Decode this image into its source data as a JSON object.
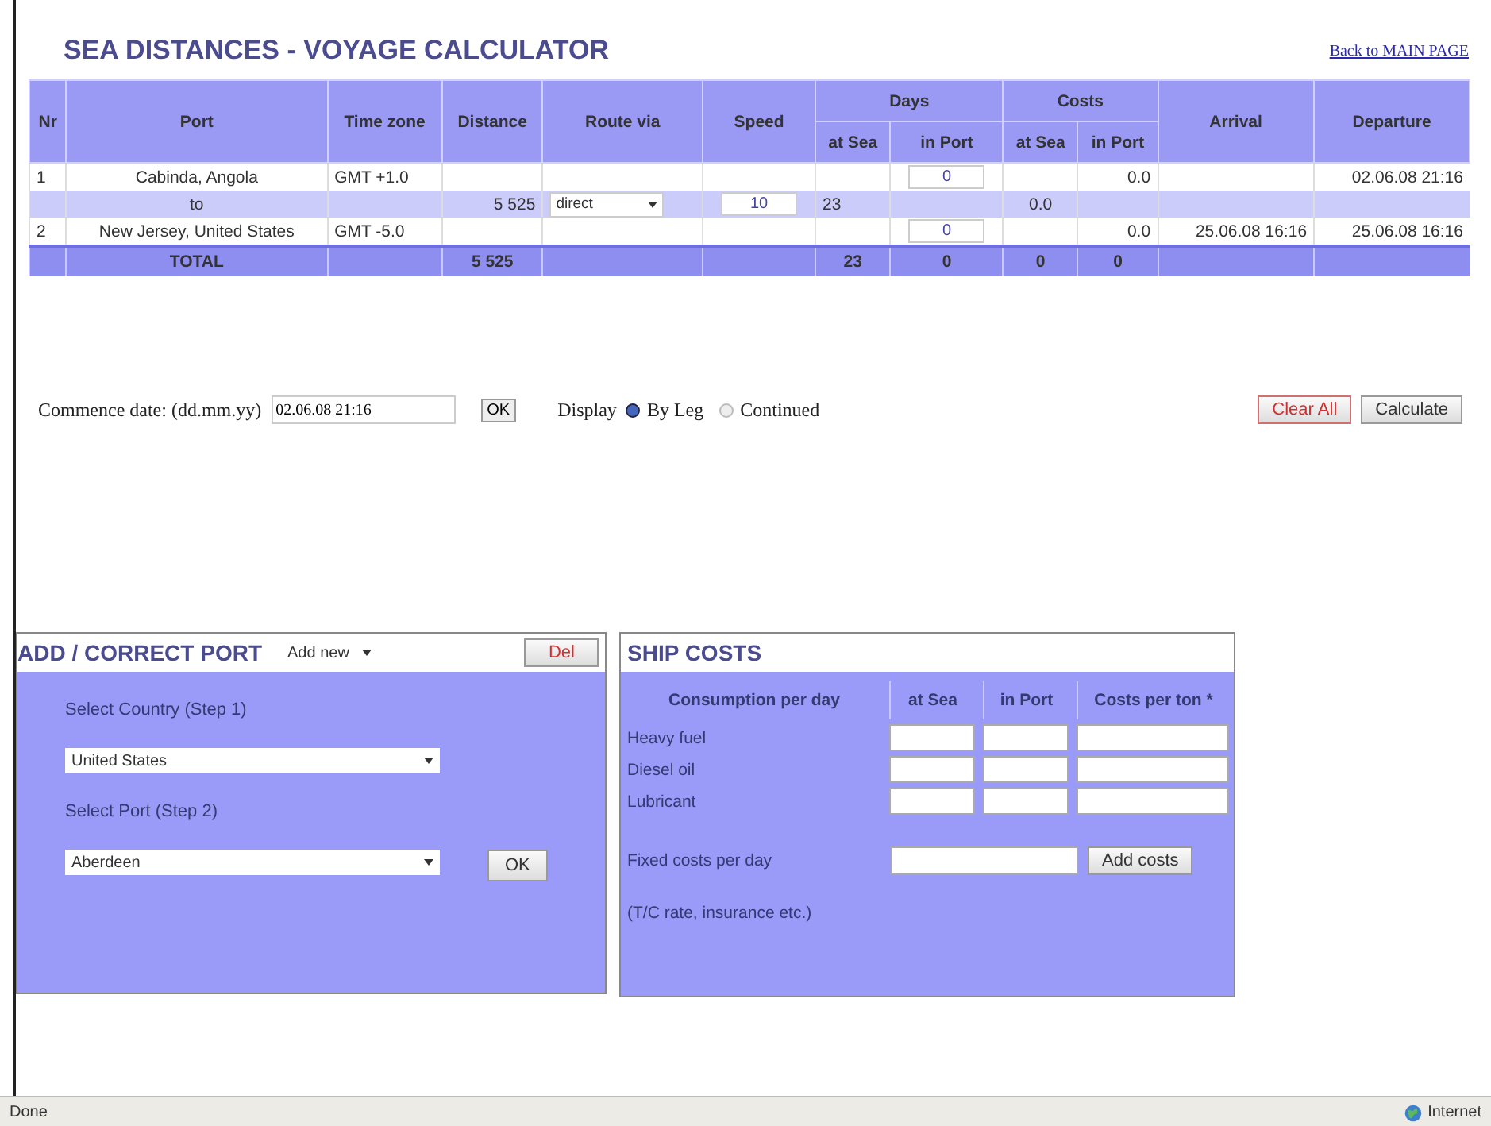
{
  "title": "SEA DISTANCES - VOYAGE CALCULATOR",
  "back_link": "Back to MAIN PAGE",
  "table": {
    "columns": [
      {
        "label": "Nr"
      },
      {
        "label": "Port"
      },
      {
        "label": "Time zone"
      },
      {
        "label": "Distance"
      },
      {
        "label": "Route via"
      },
      {
        "label": "Speed"
      },
      {
        "label": "Days",
        "subcolumns": [
          "at Sea",
          "in Port"
        ]
      },
      {
        "label": "Costs",
        "subcolumns": [
          "at Sea",
          "in Port"
        ]
      },
      {
        "label": "Arrival"
      },
      {
        "label": "Departure"
      }
    ],
    "rows": [
      {
        "kind": "port",
        "nr": "1",
        "port": "Cabinda, Angola",
        "time_zone": "GMT +1.0",
        "days_in_port": {
          "kind": "input",
          "value": "0"
        },
        "costs_in_port": "0.0",
        "departure": "02.06.08 21:16"
      },
      {
        "kind": "leg",
        "port": "to",
        "distance": "5 525",
        "route_via": {
          "kind": "select",
          "value": "direct"
        },
        "speed": {
          "kind": "input",
          "value": "10"
        },
        "days_at_sea": "23",
        "costs_at_sea": "0.0"
      },
      {
        "kind": "port",
        "nr": "2",
        "port": "New Jersey, United States",
        "time_zone": "GMT -5.0",
        "days_in_port": {
          "kind": "input",
          "value": "0"
        },
        "costs_in_port": "0.0",
        "arrival": "25.06.08 16:16",
        "departure": "25.06.08 16:16"
      },
      {
        "kind": "total",
        "port": "TOTAL",
        "distance": "5 525",
        "days_at_sea": "23",
        "days_in_port": "0",
        "costs_at_sea": "0",
        "costs_in_port": "0"
      }
    ]
  },
  "commence": {
    "label": "Commence date: (dd.mm.yy)",
    "value": "02.06.08 21:16",
    "ok": "OK"
  },
  "display": {
    "label": "Display",
    "options": [
      {
        "label": "By Leg",
        "selected": true
      },
      {
        "label": "Continued",
        "selected": false
      }
    ]
  },
  "buttons": {
    "clear": "Clear All",
    "calculate": "Calculate"
  },
  "add_port": {
    "title": "ADD / CORRECT PORT",
    "mode": "Add new",
    "del": "Del",
    "step1": "Select Country   (Step 1)",
    "country": "United States",
    "step2": "Select Port   (Step 2)",
    "port": "Aberdeen",
    "ok": "OK"
  },
  "ship_costs": {
    "title": "SHIP COSTS",
    "columns": [
      "Consumption per day",
      "at Sea",
      "in Port",
      "Costs per ton *"
    ],
    "rows": [
      "Heavy fuel",
      "Diesel oil",
      "Lubricant"
    ],
    "fixed_label": "Fixed costs per day",
    "add": "Add costs",
    "note": "(T/C rate, insurance etc.)"
  },
  "status_bar": {
    "text": "Done",
    "zone": "Internet"
  }
}
